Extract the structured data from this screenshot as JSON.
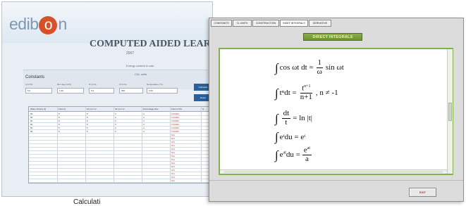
{
  "back_window": {
    "logo_pre": "edib",
    "logo_o": "o",
    "logo_post": "n",
    "title": "COMPUTED AIDED LEARNING",
    "subtitle": "2007",
    "band_title_1": "Energy content in calc",
    "band_title_2": "CAL units",
    "constants_label": "Constants",
    "input_labels": [
      "q (m³/s)",
      "Ref. deg (m³/s)",
      "t1 (mm)",
      "t2 (mm)",
      "Temperature (°C)"
    ],
    "input_values": [
      "5,0",
      "1,00",
      "5,0",
      "300",
      "0,00"
    ],
    "calculate_button": "Calculate",
    "reset_button": "Reset",
    "table_headers": [
      "Water Volume (l)",
      "Flow (l)",
      "h1 (m.h.s)",
      "h2 (m.h.s)",
      "Percentage flow",
      "Flow (m³/s)",
      "Q"
    ],
    "table_rows": [
      [
        "50",
        "5",
        "5",
        "3",
        "4",
        "0,00000"
      ],
      [
        "50",
        "5",
        "5",
        "3",
        "4",
        "0,00000"
      ],
      [
        "50",
        "5",
        "5",
        "3",
        "4",
        "0,00000"
      ],
      [
        "50",
        "5",
        "5",
        "3",
        "4",
        "0,00000"
      ],
      [
        "50",
        "5",
        "5",
        "3",
        "4",
        "0,00000"
      ],
      [
        "50",
        "5",
        "5",
        "3",
        "4",
        "0,00000"
      ]
    ],
    "empty_row_marker": "N/A"
  },
  "caption": "Calculati",
  "front_window": {
    "tabs": [
      "CONSTANTS",
      "CL UNITS",
      "CONSTRUCTION",
      "INDEF INTEGRALS",
      "DERIVATIVE"
    ],
    "active_tab_index": 3,
    "heading": "DIRECT INTEGRALS",
    "formulas": {
      "f1_left": "cos ωt dt =",
      "f1_num": "1",
      "f1_den": "ω",
      "f1_right": "sin ωt",
      "f2_left": "tⁿdt =",
      "f2_num_base": "t",
      "f2_num_exp": "n+1",
      "f2_den": "n+1",
      "f2_right": ", n ≠ -1",
      "f3_num": "dt",
      "f3_den": "t",
      "f3_right": "= ln |t|",
      "f4": "eᵗdu = eᵗ",
      "f5_left_base": "e",
      "f5_left_exp": "at",
      "f5_left_rest": "du =",
      "f5_num_base": "e",
      "f5_num_exp": "at",
      "f5_den": "a"
    },
    "exit_button": "EXIT"
  },
  "colors": {
    "accent_green": "#7fb24a",
    "heading_bar": "#6c9232",
    "logo_orange": "#d6512a",
    "button_blue": "#2a5f9e"
  }
}
